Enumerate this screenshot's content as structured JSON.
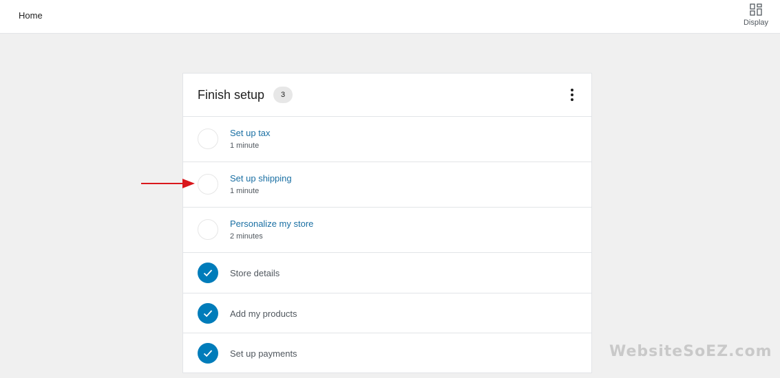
{
  "topbar": {
    "title": "Home",
    "display_label": "Display"
  },
  "setup_card": {
    "title": "Finish setup",
    "remaining_count": "3",
    "tasks": [
      {
        "title": "Set up tax",
        "time": "1 minute",
        "completed": false
      },
      {
        "title": "Set up shipping",
        "time": "1 minute",
        "completed": false
      },
      {
        "title": "Personalize my store",
        "time": "2 minutes",
        "completed": false
      },
      {
        "title": "Store details",
        "completed": true
      },
      {
        "title": "Add my products",
        "completed": true
      },
      {
        "title": "Set up payments",
        "completed": true
      }
    ]
  },
  "watermark": "WebsiteSoEZ.com",
  "colors": {
    "accent": "#007cba",
    "link": "#1a6fa3",
    "arrow": "#d9171c",
    "background": "#f0f0f0"
  },
  "icons": {
    "display": "layout-grid-icon",
    "menu": "vertical-ellipsis-icon",
    "check": "checkmark-icon",
    "arrow": "red-arrow-right-icon"
  }
}
